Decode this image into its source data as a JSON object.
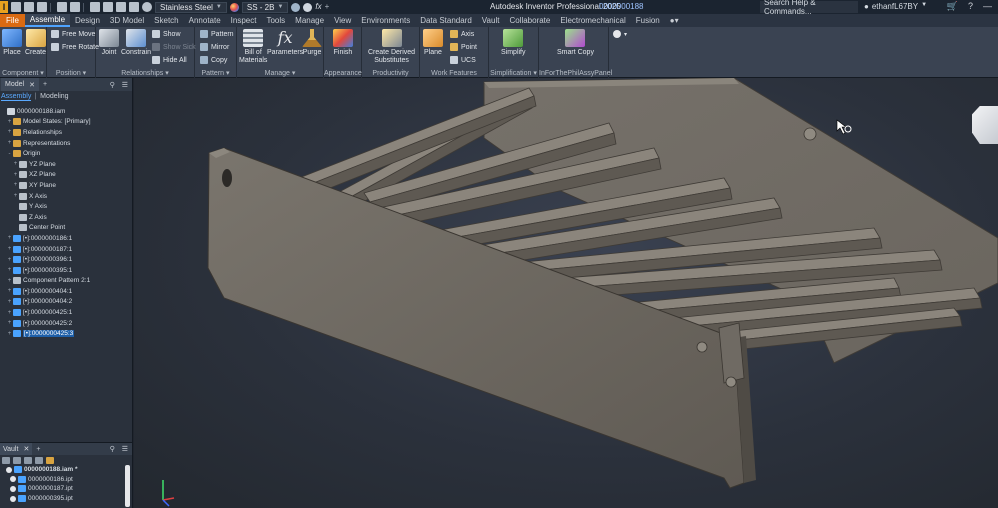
{
  "titlebar": {
    "material": "Stainless Steel",
    "appearance": "SS - 2B",
    "app_title": "Autodesk Inventor Professional 2025",
    "document": "0000000188",
    "search_placeholder": "Search Help & Commands...",
    "user": "ethanfL67BY"
  },
  "tabs": [
    "File",
    "Assemble",
    "Design",
    "3D Model",
    "Sketch",
    "Annotate",
    "Inspect",
    "Tools",
    "Manage",
    "View",
    "Environments",
    "Data Standard",
    "Vault",
    "Collaborate",
    "Electromechanical",
    "Fusion"
  ],
  "active_tab": "Assemble",
  "ribbon": {
    "component": {
      "label": "Component",
      "place": "Place",
      "create": "Create"
    },
    "position": {
      "label": "Position",
      "free_move": "Free Move",
      "free_rotate": "Free Rotate"
    },
    "relationships": {
      "label": "Relationships",
      "joint": "Joint",
      "constrain": "Constrain",
      "show": "Show",
      "show_sick": "Show Sick",
      "hide_all": "Hide All"
    },
    "pattern": {
      "label": "Pattern",
      "pattern": "Pattern",
      "mirror": "Mirror",
      "copy": "Copy"
    },
    "manage": {
      "label": "Manage",
      "bom_line1": "Bill of",
      "bom_line2": "Materials",
      "parameters": "Parameters",
      "purge": "Purge"
    },
    "appearance": {
      "label": "Appearance",
      "finish": "Finish"
    },
    "productivity": {
      "label": "Productivity",
      "derived_line1": "Create Derived",
      "derived_line2": "Substitutes"
    },
    "work_features": {
      "label": "Work Features",
      "plane": "Plane",
      "axis": "Axis",
      "point": "Point",
      "ucs": "UCS"
    },
    "simplification": {
      "label": "Simplification",
      "simplify": "Simplify"
    },
    "inforthephil": {
      "label": "InForThePhilAssyPanel",
      "smart_copy": "Smart Copy"
    }
  },
  "browser": {
    "tab": "Model",
    "mode_active": "Assembly",
    "mode_other": "Modeling",
    "tree": [
      {
        "label": "0000000188.iam",
        "level": 0,
        "expander": "",
        "icon": "#cfd6df"
      },
      {
        "label": "Model States: [Primary]",
        "level": 1,
        "expander": "+",
        "icon": "#d9a441"
      },
      {
        "label": "Relationships",
        "level": 1,
        "expander": "+",
        "icon": "#d9a441"
      },
      {
        "label": "Representations",
        "level": 1,
        "expander": "+",
        "icon": "#d9a441"
      },
      {
        "label": "Origin",
        "level": 1,
        "expander": "-",
        "icon": "#d9a441"
      },
      {
        "label": "YZ Plane",
        "level": 2,
        "expander": "+",
        "icon": "#b8c0ca"
      },
      {
        "label": "XZ Plane",
        "level": 2,
        "expander": "+",
        "icon": "#b8c0ca"
      },
      {
        "label": "XY Plane",
        "level": 2,
        "expander": "+",
        "icon": "#b8c0ca"
      },
      {
        "label": "X Axis",
        "level": 2,
        "expander": "+",
        "icon": "#b8c0ca"
      },
      {
        "label": "Y Axis",
        "level": 2,
        "expander": "",
        "icon": "#b8c0ca"
      },
      {
        "label": "Z Axis",
        "level": 2,
        "expander": "",
        "icon": "#b8c0ca"
      },
      {
        "label": "Center Point",
        "level": 2,
        "expander": "",
        "icon": "#b8c0ca"
      },
      {
        "label": "[•]:0000000186:1",
        "level": 1,
        "expander": "+",
        "icon": "#4aa3ff"
      },
      {
        "label": "[•]:0000000187:1",
        "level": 1,
        "expander": "+",
        "icon": "#4aa3ff"
      },
      {
        "label": "[•]:0000000396:1",
        "level": 1,
        "expander": "+",
        "icon": "#4aa3ff"
      },
      {
        "label": "[•]:0000000395:1",
        "level": 1,
        "expander": "+",
        "icon": "#4aa3ff"
      },
      {
        "label": "Component Pattern 2:1",
        "level": 1,
        "expander": "+",
        "icon": "#b8c0ca"
      },
      {
        "label": "[•]:0000000404:1",
        "level": 1,
        "expander": "+",
        "icon": "#4aa3ff"
      },
      {
        "label": "[•]:0000000404:2",
        "level": 1,
        "expander": "+",
        "icon": "#4aa3ff"
      },
      {
        "label": "[•]:0000000425:1",
        "level": 1,
        "expander": "+",
        "icon": "#4aa3ff"
      },
      {
        "label": "[•]:0000000425:2",
        "level": 1,
        "expander": "+",
        "icon": "#4aa3ff"
      },
      {
        "label": "[•]:0000000425:3",
        "level": 1,
        "expander": "+",
        "icon": "#4aa3ff",
        "selected": true
      }
    ]
  },
  "vault": {
    "tab": "Vault",
    "items": [
      {
        "label": "0000000188.iam *",
        "root": true
      },
      {
        "label": "0000000186.ipt",
        "root": false
      },
      {
        "label": "0000000187.ipt",
        "root": false
      },
      {
        "label": "0000000395.ipt",
        "root": false
      }
    ]
  },
  "colors": {
    "accent": "#4ea3ff",
    "file_tab": "#d96a12",
    "part": "#6f6a63",
    "background": "#2b313c"
  }
}
